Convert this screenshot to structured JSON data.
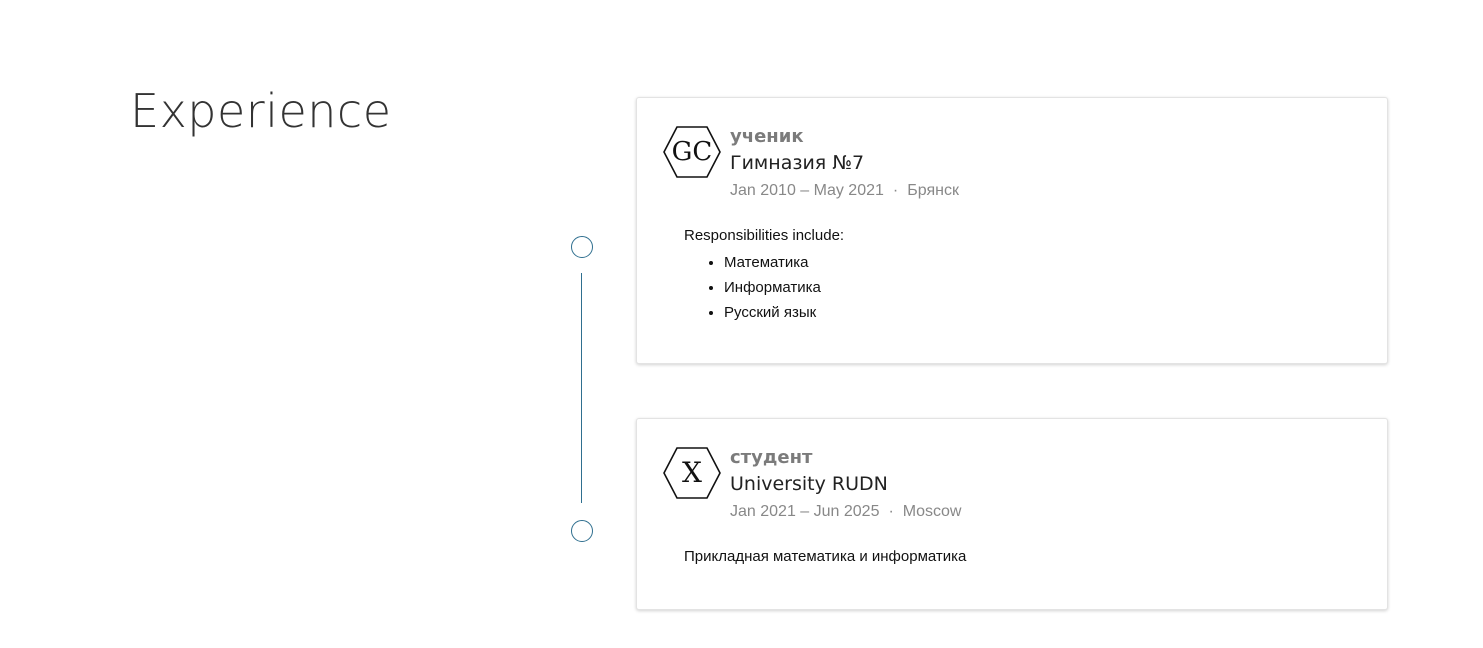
{
  "section": {
    "title": "Experience"
  },
  "experience": [
    {
      "logo_text": "GC",
      "role": "ученик",
      "organization": "Гимназия №7",
      "dates": "Jan 2010 – May 2021",
      "separator": "·",
      "location": "Брянск",
      "description_lead": "Responsibilities include:",
      "items": [
        "Математика",
        "Информатика",
        "Русский язык"
      ]
    },
    {
      "logo_text": "X",
      "role": "студент",
      "organization": "University RUDN",
      "dates": "Jan 2021 – Jun 2025",
      "separator": "·",
      "location": "Moscow",
      "description_lead": "Прикладная математика и информатика"
    }
  ],
  "colors": {
    "timeline": "#2f6f8f",
    "role_text": "#7b7b7b",
    "meta_text": "#888888"
  }
}
